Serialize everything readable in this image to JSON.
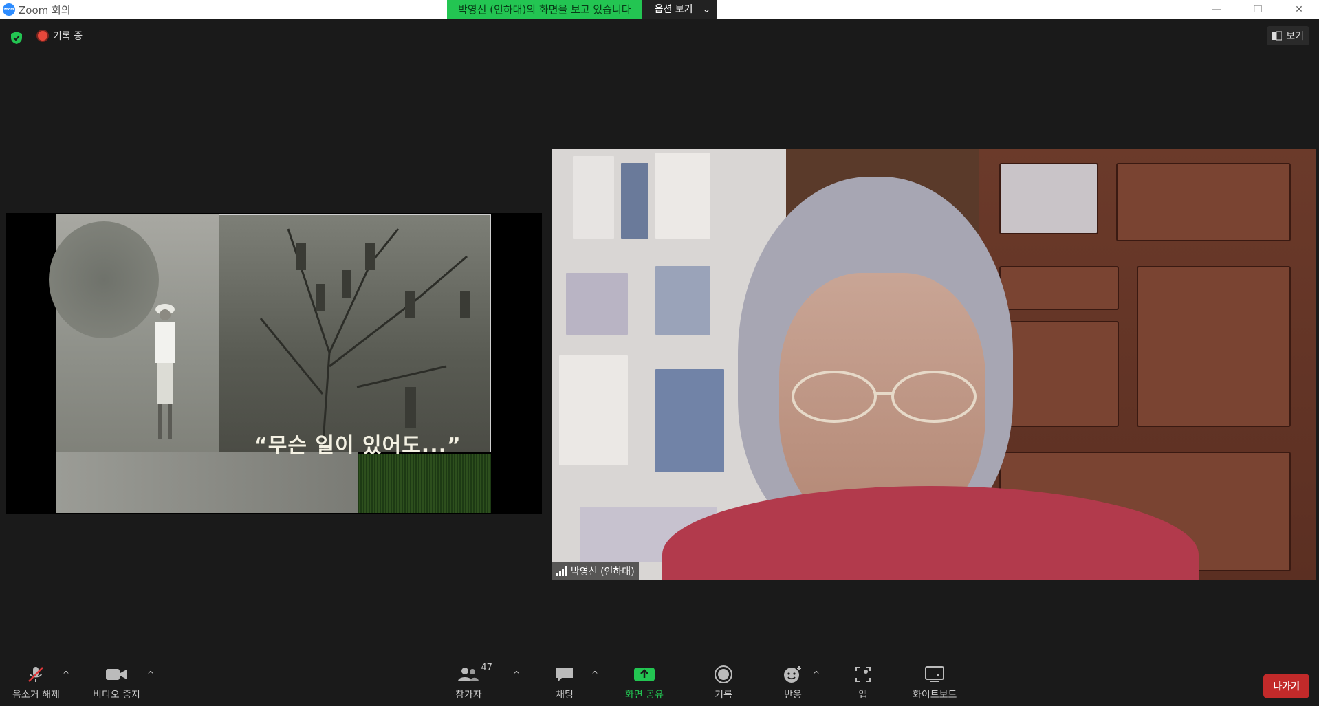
{
  "window": {
    "app_logo": "zoom",
    "title": "Zoom 회의",
    "controls": [
      "minimize-icon",
      "restore-icon",
      "close-icon"
    ]
  },
  "share_banner": {
    "message": "박영신 (인하대)의 화면을 보고 있습니다",
    "options_label": "옵션 보기",
    "accent": "#23c552"
  },
  "status": {
    "recording_label": "기록 중",
    "view_label": "보기"
  },
  "shared_screen": {
    "caption": "“무슨 일이 있어도...”"
  },
  "video": {
    "participant_name": "박영신 (인하대)"
  },
  "toolbar": {
    "mute_label": "음소거 해제",
    "video_label": "비디오 중지",
    "participants_label": "참가자",
    "participants_count": "47",
    "chat_label": "채팅",
    "share_label": "화면 공유",
    "record_label": "기록",
    "reactions_label": "반응",
    "apps_label": "앱",
    "whiteboard_label": "화이트보드",
    "leave_label": "나가기",
    "leave_color": "#c22a2a"
  }
}
